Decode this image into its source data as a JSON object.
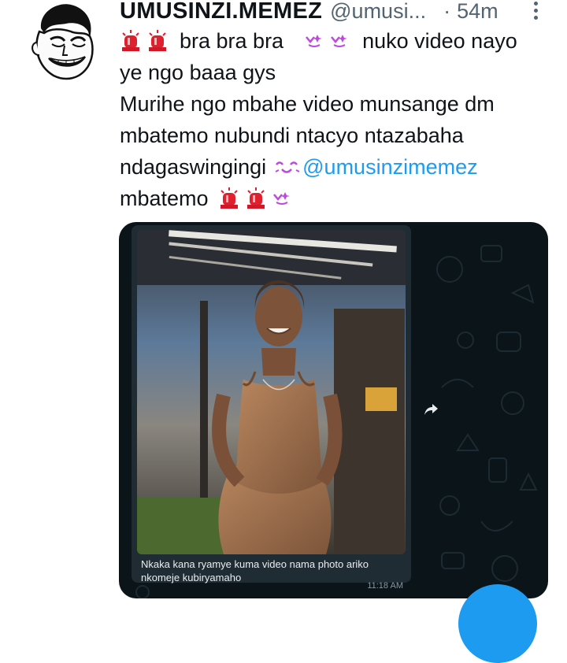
{
  "tweet": {
    "display_name": "UMUSINZI.MEMEZ",
    "handle": "@umusi...",
    "separator": "·",
    "time": "54m",
    "lines": [
      "bra bra bra",
      "nuko video nayo",
      "ye ngo baaa gys",
      "Murihe ngo mbahe video munsange dm",
      "mbatemo nubundi ntacyo ntazabaha",
      "ndagaswingingi",
      "@umusinzimemez",
      "mbatemo"
    ],
    "emojis": {
      "siren": "siren-emoji",
      "sparkle_eyes": "sparkling-eyes-emoji",
      "kiss_face": "kissing-face-emoji"
    }
  },
  "media": {
    "caption": "Nkaka kana ryamye kuma video nama photo ariko nkomeje kubiryamaho",
    "message_time": "11:18 AM"
  },
  "colors": {
    "link": "#1d9bf0",
    "muted": "#536471",
    "text": "#0f1419",
    "chat_bg": "#0b1418",
    "bubble_bg": "#1f2c34"
  }
}
